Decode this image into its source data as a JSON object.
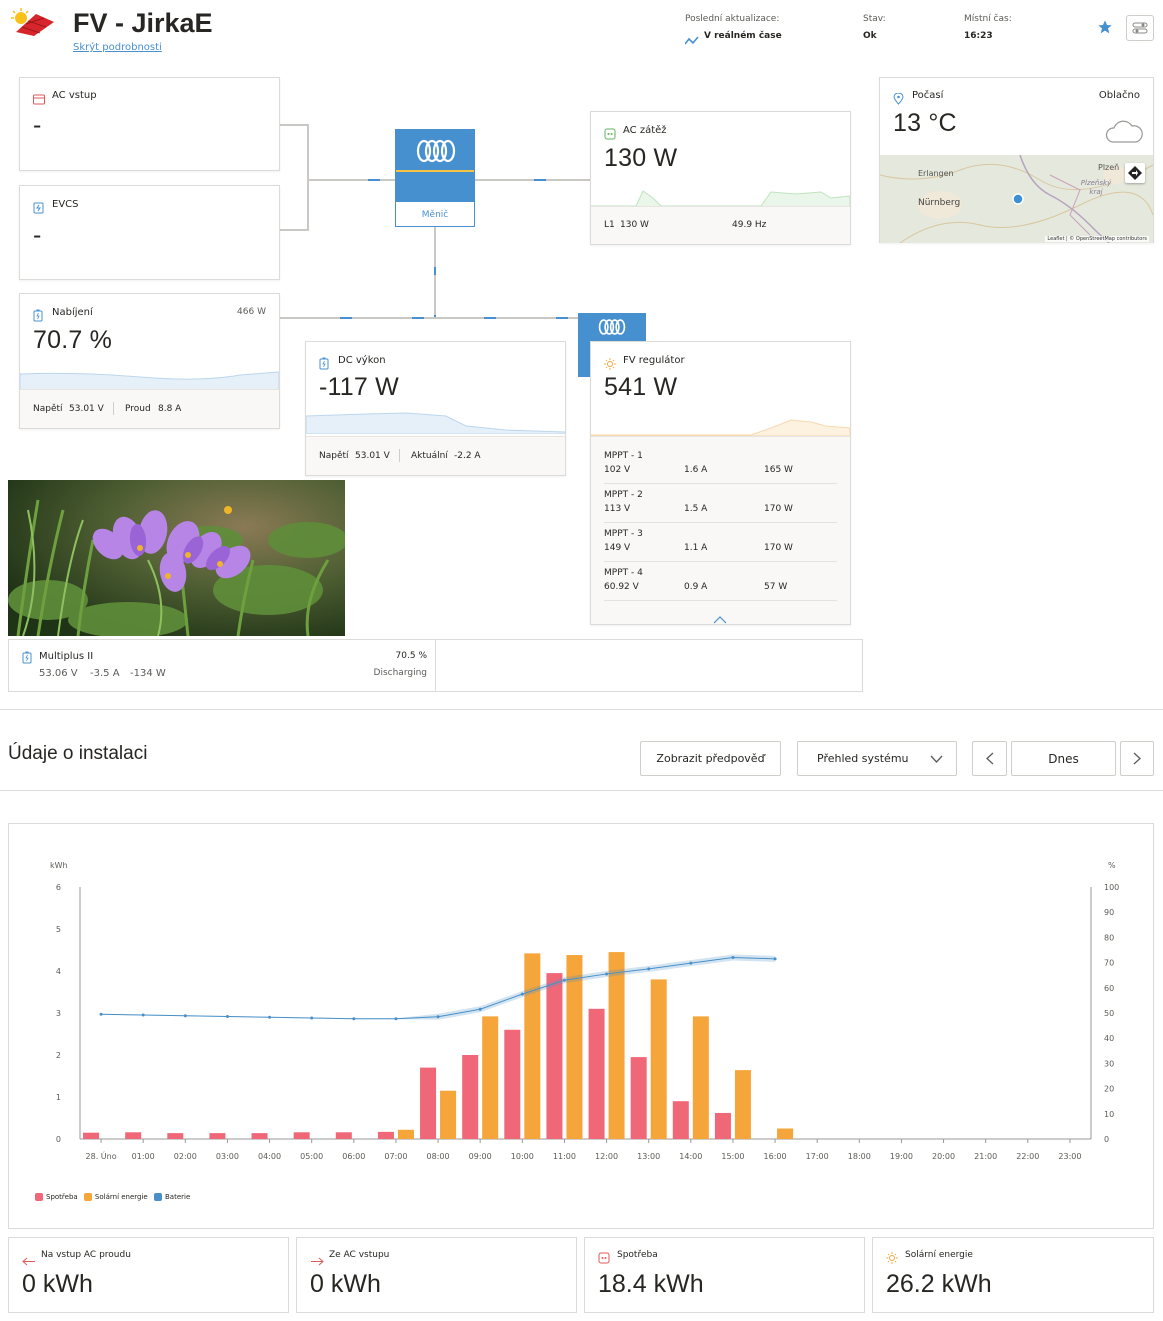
{
  "header": {
    "title": "FV - JirkaE",
    "hide_details": "Skrýt podrobnosti",
    "last_update_label": "Poslední aktualizace:",
    "last_update_value": "V reálném čase",
    "status_label": "Stav:",
    "status_value": "Ok",
    "local_time_label": "Místní čas:",
    "local_time_value": "16:23"
  },
  "ac_input": {
    "label": "AC vstup",
    "value": "-"
  },
  "evcs": {
    "label": "EVCS",
    "value": "-"
  },
  "inverter": {
    "label": "Měnič"
  },
  "ac_load": {
    "label": "AC zátěž",
    "value": "130 W",
    "l1_label": "L1",
    "l1_value": "130 W",
    "freq": "49.9 Hz"
  },
  "weather": {
    "label": "Počasí",
    "condition": "Oblačno",
    "temp": "13 °C",
    "map_cities": [
      "Erlangen",
      "Nürnberg",
      "Plzeň",
      "Plzeňský kraj"
    ],
    "attribution": "Leaflet | © OpenStreetMap contributors"
  },
  "battery": {
    "label": "Nabíjení",
    "power": "466 W",
    "soc": "70.7 %",
    "voltage_label": "Napětí",
    "voltage": "53.01 V",
    "current_label": "Proud",
    "current": "8.8 A"
  },
  "dc_power": {
    "label": "DC výkon",
    "value": "-117 W",
    "voltage_label": "Napětí",
    "voltage": "53.01 V",
    "current_label": "Aktuální",
    "current": "-2.2 A"
  },
  "pv_charger": {
    "label": "FV regulátor",
    "value": "541 W",
    "mppts": [
      {
        "name": "MPPT - 1",
        "voltage": "102 V",
        "current": "1.6 A",
        "power": "165 W"
      },
      {
        "name": "MPPT - 2",
        "voltage": "113 V",
        "current": "1.5 A",
        "power": "170 W"
      },
      {
        "name": "MPPT - 3",
        "voltage": "149 V",
        "current": "1.1 A",
        "power": "170 W"
      },
      {
        "name": "MPPT - 4",
        "voltage": "60.92 V",
        "current": "0.9 A",
        "power": "57 W"
      }
    ]
  },
  "multiplus": {
    "name": "Multiplus II",
    "voltage": "53.06 V",
    "current": "-3.5 A",
    "power": "-134 W",
    "soc": "70.5 %",
    "state": "Discharging"
  },
  "install": {
    "title": "Údaje o instalaci",
    "forecast_button": "Zobrazit předpověď",
    "view_select": "Přehled systému",
    "date_label": "Dnes"
  },
  "chart_data": {
    "type": "bar",
    "ylabel": "kWh",
    "y2label": "%",
    "ylim": [
      0,
      6
    ],
    "y2lim": [
      0,
      100
    ],
    "yticks": [
      "0",
      "1",
      "2",
      "3",
      "4",
      "5",
      "6"
    ],
    "y2ticks": [
      "0",
      "10",
      "20",
      "30",
      "40",
      "50",
      "60",
      "70",
      "80",
      "90",
      "100"
    ],
    "categories": [
      "28. Úno",
      "01:00",
      "02:00",
      "03:00",
      "04:00",
      "05:00",
      "06:00",
      "07:00",
      "08:00",
      "09:00",
      "10:00",
      "11:00",
      "12:00",
      "13:00",
      "14:00",
      "15:00",
      "16:00",
      "17:00",
      "18:00",
      "19:00",
      "20:00",
      "21:00",
      "22:00",
      "23:00"
    ],
    "series": [
      {
        "name": "Spotřeba",
        "color": "#f06878",
        "values": [
          0.15,
          0.16,
          0.14,
          0.14,
          0.14,
          0.16,
          0.16,
          0.17,
          1.7,
          2.0,
          2.6,
          3.95,
          3.1,
          1.95,
          0.9,
          0.62,
          null,
          null,
          null,
          null,
          null,
          null,
          null,
          null
        ]
      },
      {
        "name": "Solární energie",
        "color": "#f5a53a",
        "values": [
          null,
          null,
          null,
          null,
          null,
          null,
          null,
          0.22,
          1.15,
          2.92,
          4.42,
          4.38,
          4.45,
          3.8,
          2.92,
          1.64,
          0.25,
          null,
          null,
          null,
          null,
          null,
          null,
          null
        ]
      },
      {
        "name": "Baterie",
        "color": "#4a90c8",
        "values": [
          49.5,
          49.2,
          48.9,
          48.6,
          48.3,
          48.0,
          47.7,
          47.7,
          48.5,
          51.5,
          57.5,
          63.0,
          65.5,
          67.5,
          69.8,
          72.0,
          71.5,
          null,
          null,
          null,
          null,
          null,
          null,
          null
        ]
      }
    ],
    "legend": "bottom-left"
  },
  "summary": [
    {
      "label": "Na vstup AC proudu",
      "value": "0 kWh"
    },
    {
      "label": "Ze AC vstupu",
      "value": "0 kWh"
    },
    {
      "label": "Spotřeba",
      "value": "18.4 kWh"
    },
    {
      "label": "Solární energie",
      "value": "26.2 kWh"
    }
  ]
}
